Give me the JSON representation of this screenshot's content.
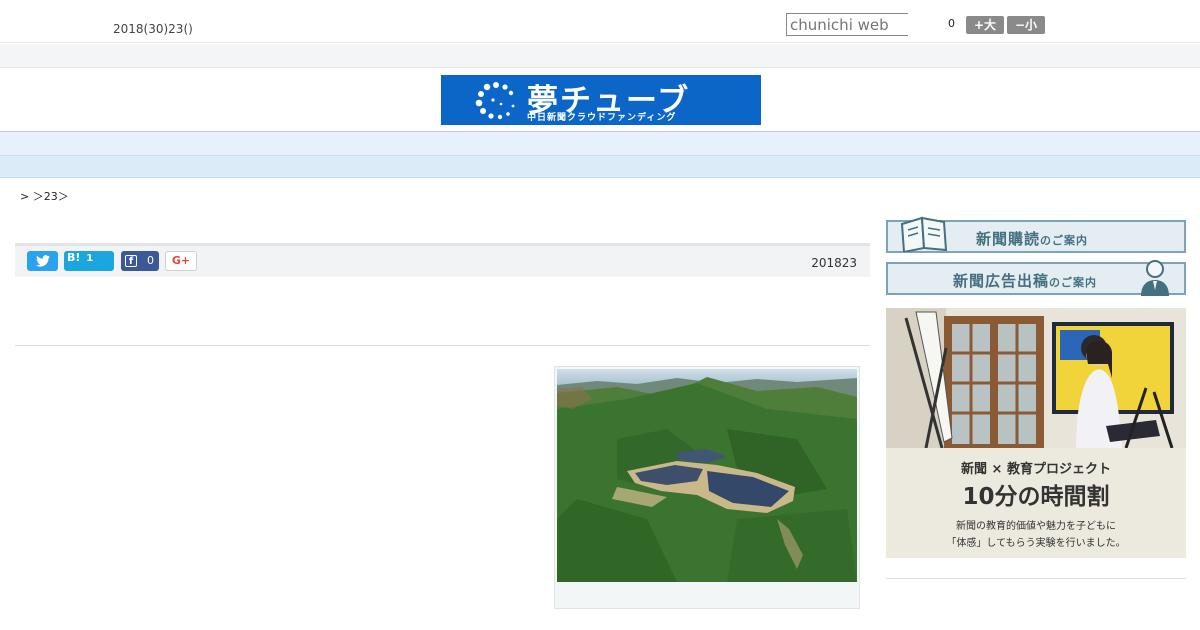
{
  "header": {
    "date": "2018(30)23()",
    "search_placeholder": "chunichi web",
    "font_size_value": "0",
    "font_larger": "+大",
    "font_smaller": "−小"
  },
  "logo": {
    "title": "夢チューブ",
    "subtitle": "中日新聞クラウドファンディング"
  },
  "nav": {
    "items": [
      "",
      "",
      "",
      "",
      "",
      "",
      "",
      "",
      ""
    ]
  },
  "breadcrumb": "> ＞23＞",
  "share": {
    "twitter_icon": "twitter-bird-icon",
    "hatena_label": "B!",
    "hatena_count": "1",
    "facebook_count": "0",
    "googleplus_label": "G+",
    "pub_date": "201823"
  },
  "sidebar": {
    "banner1": {
      "main": "新聞購読",
      "suffix": "のご案内"
    },
    "banner2": {
      "main": "新聞広告出稿",
      "suffix": "のご案内"
    },
    "ad": {
      "head": "新聞 × 教育プロジェクト",
      "big": "10分の時間割",
      "line1": "新聞の教育的価値や魅力を子どもに",
      "line2": "「体感」してもらう実験を行いました。"
    }
  },
  "colors": {
    "logo_bg": "#0b66c8",
    "nav_bg": "#e8f1fb",
    "twitter": "#2aa3ef",
    "hatena": "#1ba6e0",
    "facebook": "#3b5998",
    "googleplus": "#dd4b39",
    "banner_text": "#45707f"
  }
}
